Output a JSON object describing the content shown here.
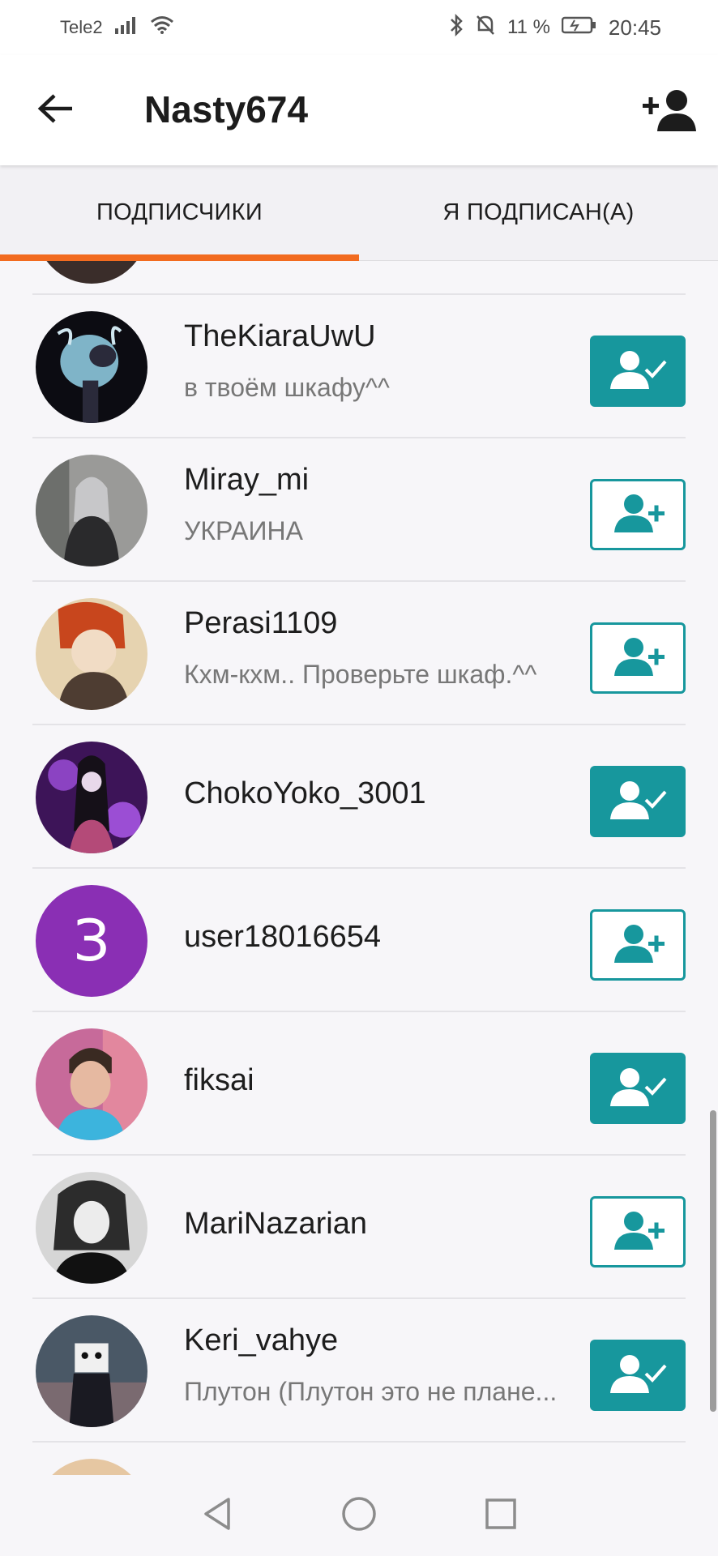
{
  "status_bar": {
    "carrier": "Tele2",
    "battery": "11 %",
    "time": "20:45"
  },
  "header": {
    "title": "Nasty674",
    "back_icon": "arrow-left-icon",
    "add_icon": "add-user-icon"
  },
  "tabs": [
    {
      "label": "ПОДПИСЧИКИ",
      "active": true
    },
    {
      "label": "Я ПОДПИСАН(А)",
      "active": false
    }
  ],
  "colors": {
    "accent": "#f26b1f",
    "teal": "#17979d",
    "avatar_purple": "#8a2fb4"
  },
  "users": [
    {
      "name": "TheKiaraUwU",
      "status": "в твоём шкафу^^",
      "following": true
    },
    {
      "name": "Miray_mi",
      "status": "УКРАИНА",
      "following": false
    },
    {
      "name": "Perasi1109",
      "status": "Кхм-кхм.. Проверьте шкаф.^^",
      "following": false
    },
    {
      "name": "ChokoYoko_3001",
      "status": "",
      "following": true
    },
    {
      "name": "user18016654",
      "status": "",
      "following": false,
      "avatar_letter": "З"
    },
    {
      "name": "fiksai",
      "status": "",
      "following": true
    },
    {
      "name": "MariNazarian",
      "status": "",
      "following": false
    },
    {
      "name": "Keri_vahye",
      "status": "Плутон (Плутон это не плане...",
      "following": true
    }
  ],
  "nav": {
    "back": "triangle-back-icon",
    "home": "circle-home-icon",
    "recents": "square-recents-icon"
  }
}
